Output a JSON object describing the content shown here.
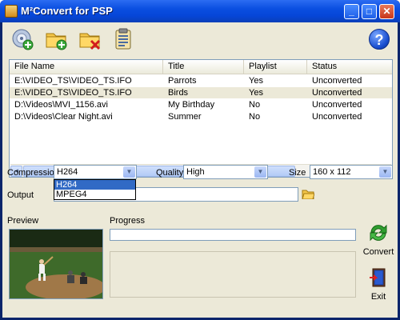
{
  "window": {
    "title": "M²Convert for PSP",
    "minimize_label": "_",
    "maximize_label": "□",
    "close_label": "✕"
  },
  "toolbar": {
    "buttons": [
      {
        "icon": "add-disc-icon"
      },
      {
        "icon": "add-folder-icon"
      },
      {
        "icon": "remove-folder-icon"
      },
      {
        "icon": "clipboard-list-icon"
      }
    ],
    "help_label": "?"
  },
  "file_list": {
    "columns": [
      "File Name",
      "Title",
      "Playlist",
      "Status"
    ],
    "rows": [
      {
        "file": "E:\\VIDEO_TS\\VIDEO_TS.IFO",
        "title": "Parrots",
        "playlist": "Yes",
        "status": "Unconverted",
        "selected": false
      },
      {
        "file": "E:\\VIDEO_TS\\VIDEO_TS.IFO",
        "title": "Birds",
        "playlist": "Yes",
        "status": "Unconverted",
        "selected": true
      },
      {
        "file": "D:\\Videos\\MVI_1156.avi",
        "title": "My Birthday",
        "playlist": "No",
        "status": "Unconverted",
        "selected": false
      },
      {
        "file": "D:\\Videos\\Clear Night.avi",
        "title": "Summer",
        "playlist": "No",
        "status": "Unconverted",
        "selected": false
      }
    ],
    "scroll_left": "◄",
    "scroll_right": "►"
  },
  "settings": {
    "compression_label": "Compression",
    "compression_value": "H264",
    "compression_options": [
      "H264",
      "MPEG4"
    ],
    "compression_highlighted": "H264",
    "quality_label": "Quality",
    "quality_value": "High",
    "size_label": "Size",
    "size_value": "160 x 112",
    "dropdown_arrow": "▼",
    "output_label": "Output",
    "output_value": ""
  },
  "preview": {
    "label": "Preview"
  },
  "progress": {
    "label": "Progress",
    "value": 0
  },
  "actions": {
    "convert_label": "Convert",
    "exit_label": "Exit"
  },
  "colors": {
    "title_bar": "#0a4ee0",
    "selection": "#316ac5",
    "client_bg": "#ece9d8"
  }
}
